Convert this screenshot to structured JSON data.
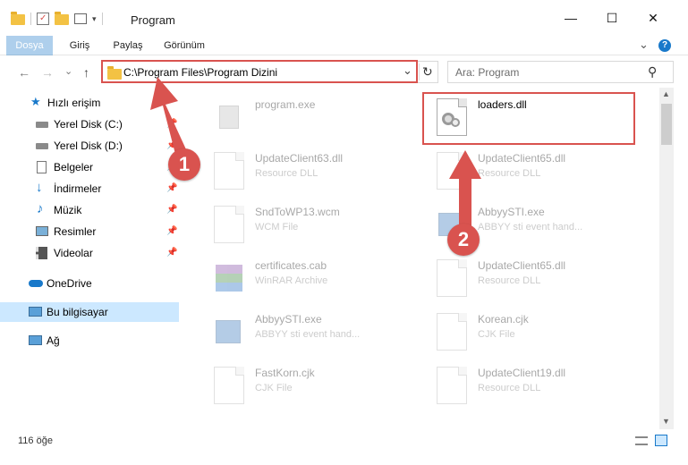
{
  "window": {
    "title": "Program",
    "minimize_glyph": "—",
    "maximize_glyph": "☐",
    "close_glyph": "✕"
  },
  "ribbon": {
    "tabs": [
      "Dosya",
      "Giriş",
      "Paylaş",
      "Görünüm"
    ],
    "expand_glyph": "⌄",
    "help_glyph": "?"
  },
  "nav": {
    "back_glyph": "←",
    "forward_glyph": "→",
    "recent_glyph": "⌄",
    "up_glyph": "↑"
  },
  "address": {
    "path": "C:\\Program Files\\Program Dizini",
    "dropdown_glyph": "⌄",
    "refresh_glyph": "↻"
  },
  "search": {
    "placeholder": "Ara: Program",
    "icon_glyph": "⚲"
  },
  "sidebar": {
    "items": [
      {
        "label": "Hızlı erişim",
        "icon": "star-icon"
      },
      {
        "label": "Yerel Disk (C:)",
        "icon": "drive-icon"
      },
      {
        "label": "Yerel Disk (D:)",
        "icon": "drive-icon"
      },
      {
        "label": "Belgeler",
        "icon": "documents-icon"
      },
      {
        "label": "İndirmeler",
        "icon": "download-icon"
      },
      {
        "label": "Müzik",
        "icon": "music-icon"
      },
      {
        "label": "Resimler",
        "icon": "pictures-icon"
      },
      {
        "label": "Videolar",
        "icon": "video-icon"
      },
      {
        "label": "OneDrive",
        "icon": "cloud-icon"
      },
      {
        "label": "Bu bilgisayar",
        "icon": "computer-icon"
      },
      {
        "label": "Ağ",
        "icon": "network-icon"
      }
    ]
  },
  "files": [
    {
      "name": "program.exe",
      "type": ""
    },
    {
      "name": "loaders.dll",
      "type": ""
    },
    {
      "name": "UpdateClient63.dll",
      "type": "Resource DLL"
    },
    {
      "name": "UpdateClient65.dll",
      "type": "Resource DLL"
    },
    {
      "name": "SndToWP13.wcm",
      "type": "WCM File"
    },
    {
      "name": "AbbyySTI.exe",
      "type": "ABBYY sti event hand..."
    },
    {
      "name": "certificates.cab",
      "type": "WinRAR Archive"
    },
    {
      "name": "UpdateClient65.dll",
      "type": "Resource DLL"
    },
    {
      "name": "AbbyySTI.exe",
      "type": "ABBYY sti event hand..."
    },
    {
      "name": "Korean.cjk",
      "type": "CJK File"
    },
    {
      "name": "FastKorn.cjk",
      "type": "CJK File"
    },
    {
      "name": "UpdateClient19.dll",
      "type": "Resource DLL"
    }
  ],
  "status": {
    "item_count": "116 öğe"
  },
  "annotations": {
    "step1": "1",
    "step2": "2",
    "highlight_color": "#d9534f"
  },
  "colors": {
    "accent": "#1979ca",
    "selected_bg": "#cce8ff",
    "folder": "#f3c244"
  }
}
